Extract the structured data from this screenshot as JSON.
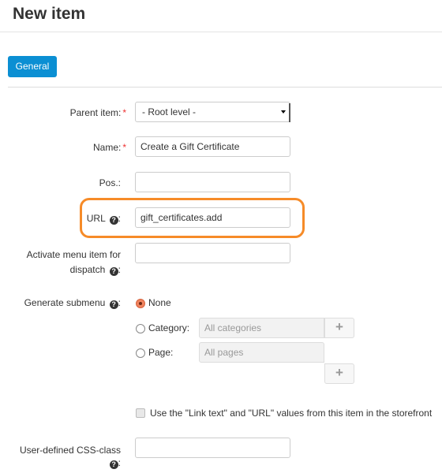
{
  "header": {
    "title": "New item"
  },
  "tabs": [
    {
      "label": "General",
      "active": true
    }
  ],
  "form": {
    "parent_item": {
      "label": "Parent item:",
      "required_mark": "*",
      "value": "- Root level -"
    },
    "name": {
      "label": "Name:",
      "required_mark": "*",
      "value": "Create a Gift Certificate"
    },
    "position": {
      "label": "Pos.:",
      "value": ""
    },
    "url": {
      "label": "URL",
      "suffix": ":",
      "help": "?",
      "value": "gift_certificates.add"
    },
    "dispatch": {
      "label_line1": "Activate menu item for",
      "label_line2": "dispatch",
      "suffix": ":",
      "help": "?",
      "value": ""
    },
    "submenu": {
      "label": "Generate submenu",
      "suffix": ":",
      "help": "?",
      "options": [
        {
          "label": "None",
          "checked": true
        },
        {
          "label": "Category:",
          "checked": false,
          "placeholder": "All categories",
          "button": "+"
        },
        {
          "label": "Page:",
          "checked": false,
          "placeholder": "All pages",
          "button": "+"
        }
      ]
    },
    "use_link_text": {
      "label": "Use the \"Link text\" and \"URL\" values from this item in the storefront",
      "checked": false
    },
    "css_class": {
      "label": "User-defined CSS-class",
      "suffix": ":",
      "help": "?",
      "value": ""
    }
  },
  "colors": {
    "accent": "#0b8fd3",
    "highlight": "#f68b28",
    "required": "#e33333",
    "radio_checked": "#f0845f"
  }
}
